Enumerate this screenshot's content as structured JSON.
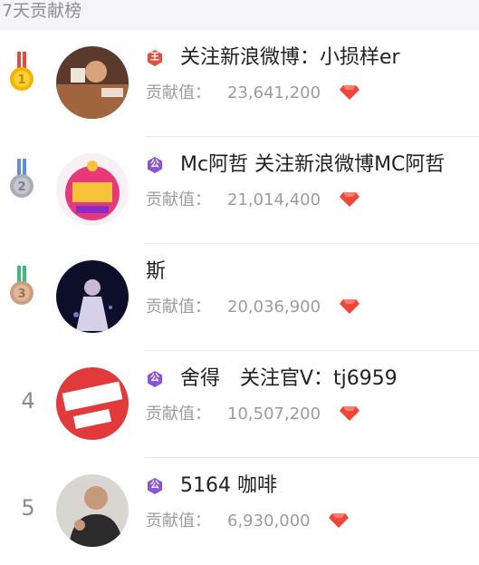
{
  "header": {
    "title": "7天贡献榜"
  },
  "contrib_label": "贡献值：",
  "rows": [
    {
      "rank": "1",
      "medal": "gold",
      "badge": "王",
      "badge_color": "#e0523f",
      "name": "关注新浪微博：小损样er",
      "value": "23,641,200"
    },
    {
      "rank": "2",
      "medal": "silver",
      "badge": "公",
      "badge_color": "#8a54d6",
      "name": "Mc阿哲 关注新浪微博MC阿哲",
      "value": "21,014,400"
    },
    {
      "rank": "3",
      "medal": "bronze",
      "badge": "",
      "name": "斯",
      "value": "20,036,900"
    },
    {
      "rank": "4",
      "badge": "公",
      "badge_color": "#8a54d6",
      "name": "舍得　关注官V：tj6959",
      "value": "10,507,200"
    },
    {
      "rank": "5",
      "badge": "公",
      "badge_color": "#8a54d6",
      "name": "5164 咖啡",
      "value": "6,930,000"
    }
  ],
  "colors": {
    "gem": "#f0463a",
    "gold": "#f4b400",
    "silver": "#a9adb5",
    "bronze": "#caa080"
  }
}
